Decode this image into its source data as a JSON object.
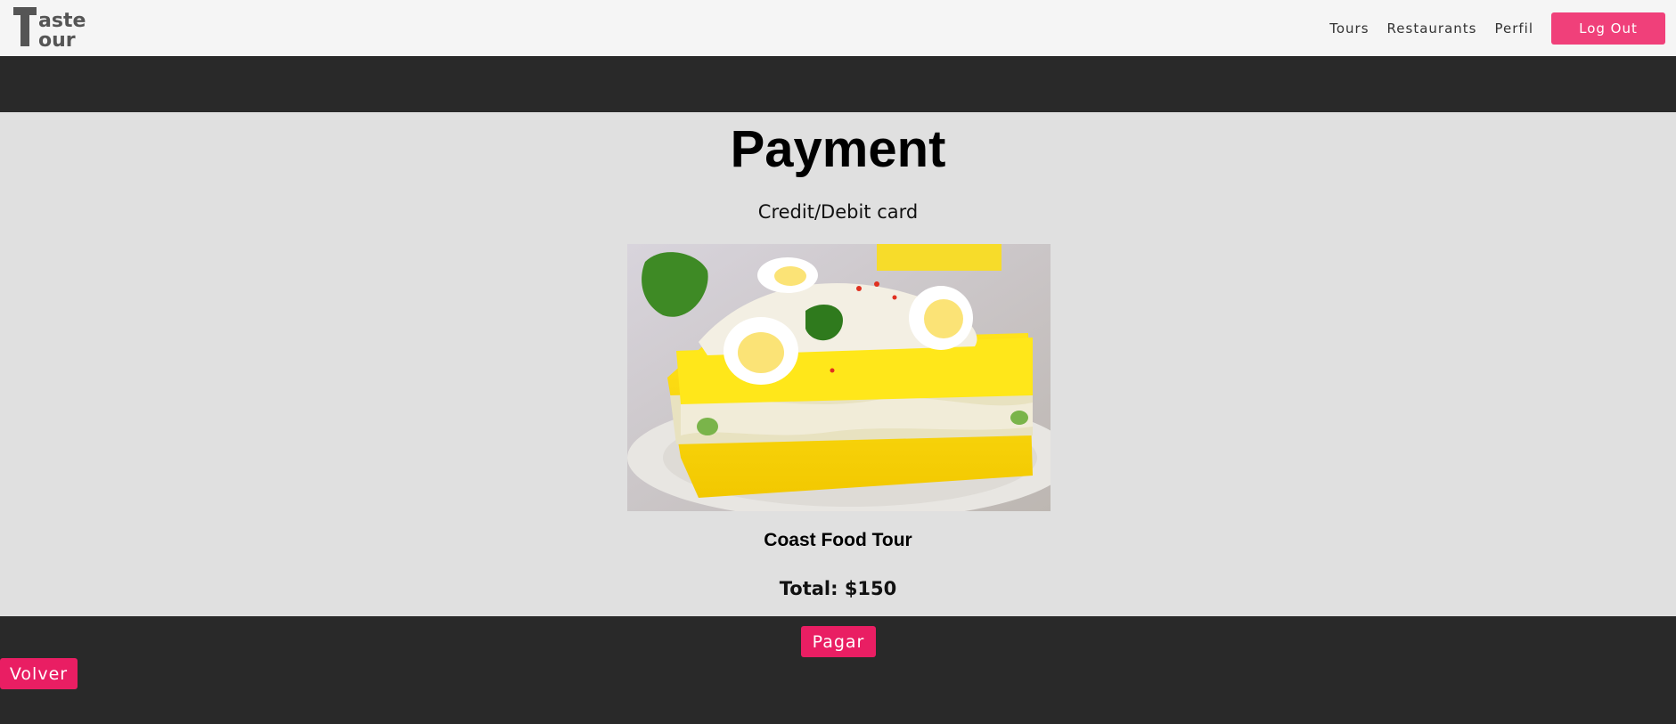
{
  "navbar": {
    "logo_text_top": "aste",
    "logo_text_bottom": "our",
    "logo_letter": "T",
    "links": [
      "Tours",
      "Restaurants",
      "Perfil"
    ],
    "logout_label": "Log Out"
  },
  "main": {
    "title": "Payment",
    "subtitle": "Credit/Debit card",
    "image_alt": "causa-dish-image",
    "tour_name": "Coast Food Tour",
    "total": "Total: $150"
  },
  "footer": {
    "pay_label": "Pagar",
    "back_label": "Volver"
  },
  "colors": {
    "accent": "#f0407a",
    "button": "#e91e63",
    "dark": "#292929",
    "light": "#e0e0e0"
  }
}
